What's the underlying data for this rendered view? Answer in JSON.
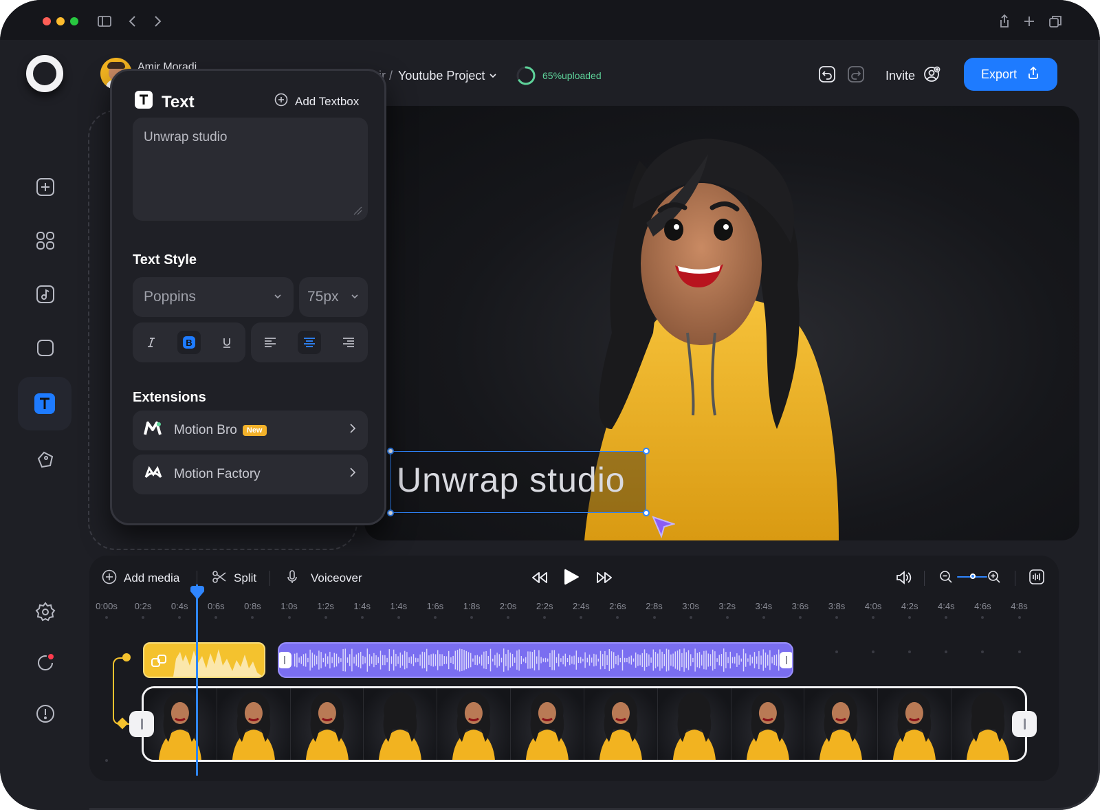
{
  "topbar": {
    "user_name": "Amir Moradi",
    "breadcrumb_prefix": "mir /",
    "project_title": "Youtube Project",
    "upload_status": "65%uploaded",
    "upload_progress": 0.65,
    "invite_label": "Invite",
    "export_label": "Export"
  },
  "text_panel": {
    "title": "Text",
    "add_textbox_label": "Add Textbox",
    "textbox_value": "Unwrap studio",
    "text_style_heading": "Text Style",
    "font_family": "Poppins",
    "font_size": "75px",
    "active_format": "bold",
    "active_align": "center",
    "extensions_heading": "Extensions",
    "extensions": [
      {
        "label": "Motion Bro",
        "badge": "New"
      },
      {
        "label": "Motion Factory",
        "badge": ""
      }
    ]
  },
  "canvas": {
    "overlay_text": "Unwrap studio"
  },
  "timeline": {
    "add_media_label": "Add media",
    "split_label": "Split",
    "voiceover_label": "Voiceover",
    "ticks": [
      "0:00s",
      "0:2s",
      "0:4s",
      "0:6s",
      "0:8s",
      "1:0s",
      "1:2s",
      "1:4s",
      "1:4s",
      "1:6s",
      "1:8s",
      "2:0s",
      "2:2s",
      "2:4s",
      "2:6s",
      "2:8s",
      "3:0s",
      "3:2s",
      "3:4s",
      "3:6s",
      "3:8s",
      "4:0s",
      "4:2s",
      "4:4s",
      "4:6s",
      "4:8s"
    ]
  },
  "colors": {
    "accent": "#1e7bff",
    "upload_green": "#5ed39a",
    "audio_yellow": "#f4c22e",
    "audio_purple": "#7a6ef0",
    "hoodie": "#f2b320"
  }
}
